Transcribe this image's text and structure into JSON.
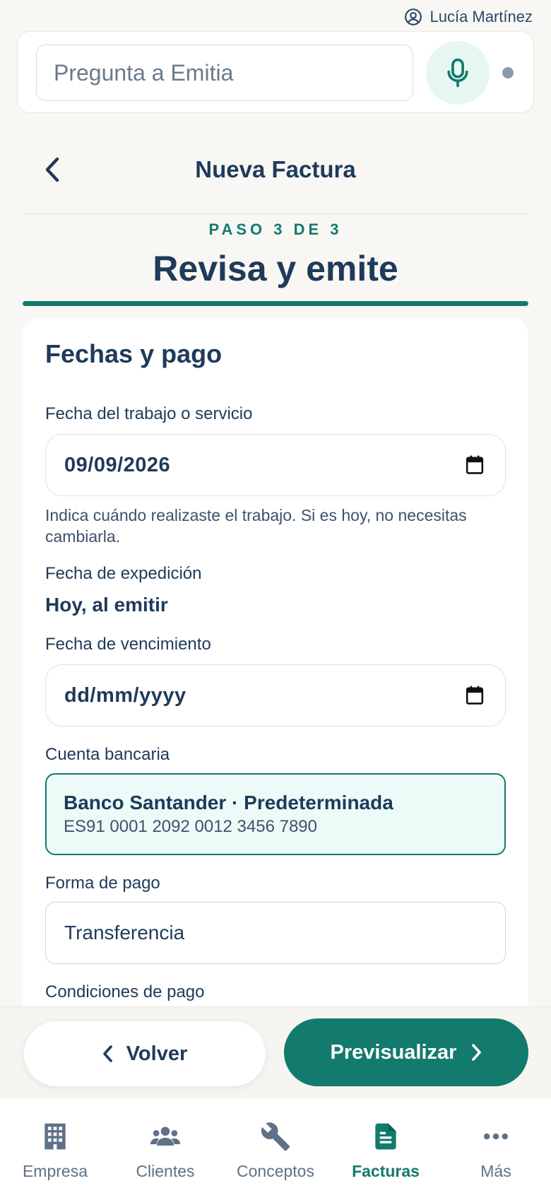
{
  "user": {
    "name": "Lucía Martínez",
    "icon": "user-circle-icon"
  },
  "assistant": {
    "placeholder": "Pregunta a Emitia",
    "mic_icon": "microphone-icon"
  },
  "header": {
    "title": "Nueva Factura",
    "back_icon": "chevron-left-icon"
  },
  "step": {
    "label": "PASO 3 DE 3",
    "title": "Revisa y emite",
    "current": 3,
    "total": 3
  },
  "section": {
    "title": "Fechas y pago",
    "work_date": {
      "label": "Fecha del trabajo o servicio",
      "value": "09/09/2026",
      "help": "Indica cuándo realizaste el trabajo. Si es hoy, no necesitas cambiarla."
    },
    "issue_date": {
      "label": "Fecha de expedición",
      "value": "Hoy, al emitir"
    },
    "due_date": {
      "label": "Fecha de vencimiento",
      "placeholder": "dd/mm/yyyy"
    },
    "bank_account": {
      "label": "Cuenta bancaria",
      "name": "Banco Santander · Predeterminada",
      "iban": "ES91 0001 2092 0012 3456 7890"
    },
    "payment_method": {
      "label": "Forma de pago",
      "value": "Transferencia"
    },
    "payment_terms": {
      "label": "Condiciones de pago"
    }
  },
  "actions": {
    "back": "Volver",
    "preview": "Previsualizar"
  },
  "nav": [
    {
      "label": "Empresa",
      "icon": "building-icon",
      "active": false
    },
    {
      "label": "Clientes",
      "icon": "users-icon",
      "active": false
    },
    {
      "label": "Conceptos",
      "icon": "wrench-icon",
      "active": false
    },
    {
      "label": "Facturas",
      "icon": "document-icon",
      "active": true
    },
    {
      "label": "Más",
      "icon": "more-horizontal-icon",
      "active": false
    }
  ],
  "colors": {
    "accent": "#137a6e",
    "text": "#1f3a5a",
    "bank_bg": "#ecfbf7",
    "background": "#f8f7f4"
  }
}
